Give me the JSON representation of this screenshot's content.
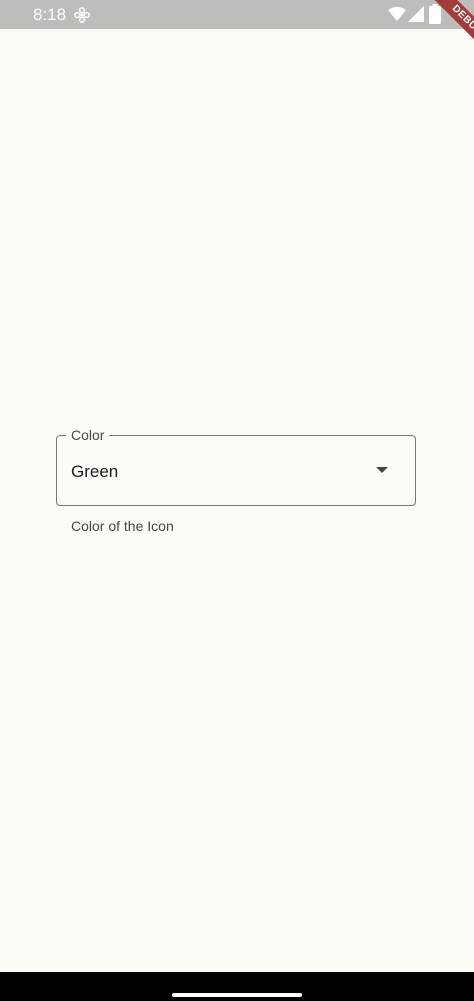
{
  "status_bar": {
    "time": "8:18",
    "app_icon": "pinwheel-icon",
    "wifi_icon": "wifi-icon",
    "signal_icon": "signal-icon",
    "battery_icon": "battery-icon",
    "text_color": "#FFFFFF",
    "background": "#BDBEB9"
  },
  "debug_banner": {
    "label": "DEBUG",
    "color": "#A33B3B"
  },
  "form": {
    "color_field": {
      "label": "Color",
      "value": "Green",
      "helper_text": "Color of the Icon",
      "arrow_icon": "arrow-drop-down-icon"
    }
  },
  "colors": {
    "background": "#FCFDF7",
    "outline": "#767873",
    "text_primary": "#1A1C18",
    "text_secondary": "#45483F"
  }
}
